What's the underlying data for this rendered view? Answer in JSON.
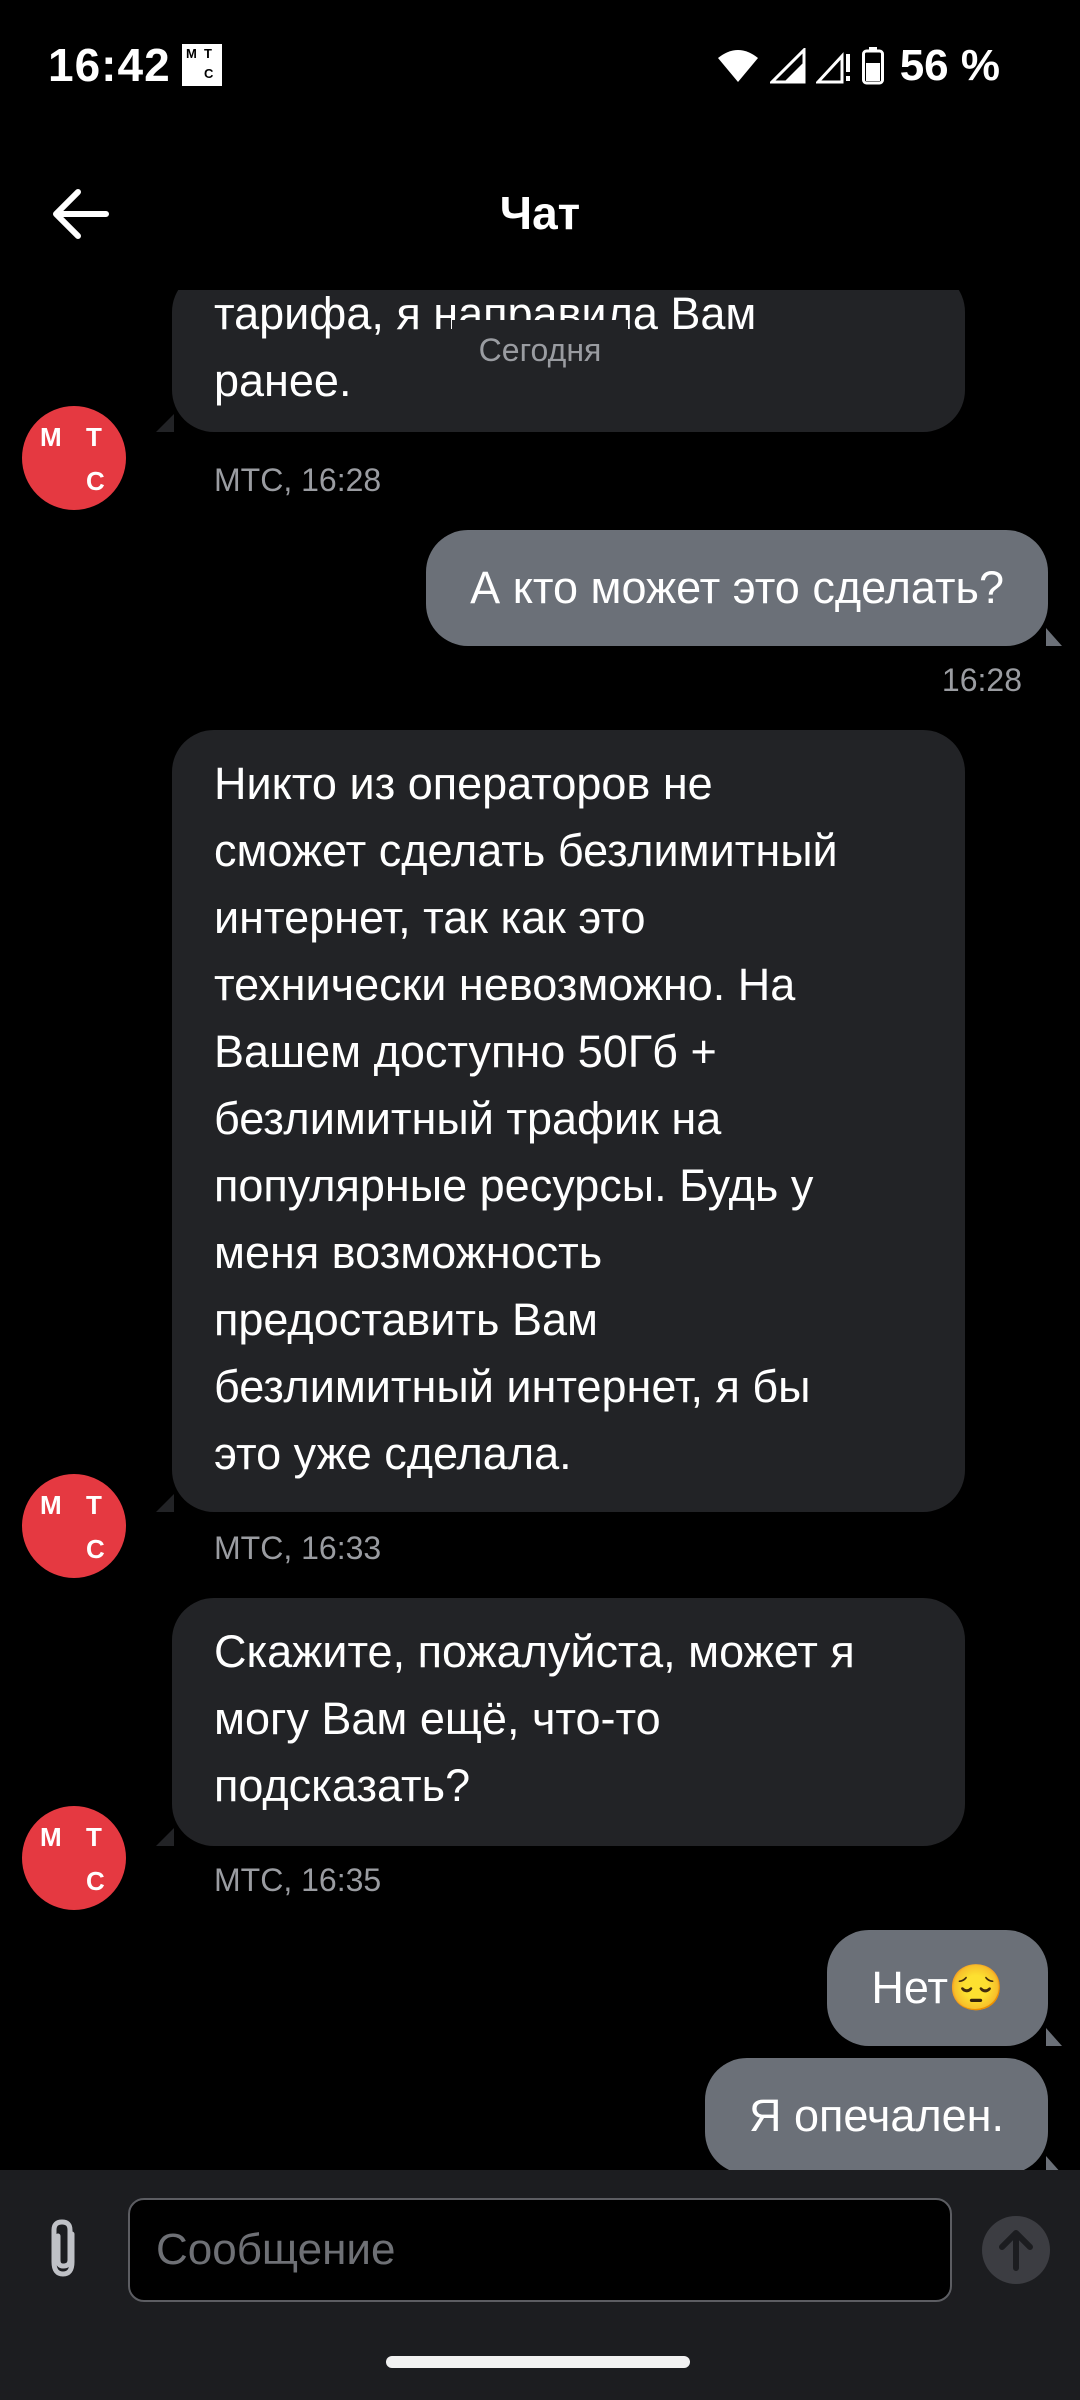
{
  "status_bar": {
    "time": "16:42",
    "carrier_logo_letters": [
      "М",
      "Т",
      "С"
    ],
    "battery_percent": "56 %",
    "icons": [
      "wifi-icon",
      "signal-icon",
      "signal-alert-icon",
      "battery-icon"
    ]
  },
  "header": {
    "title": "Чат",
    "back_icon": "arrow-left-icon"
  },
  "chat": {
    "date_separator": "Сегодня",
    "avatar_letters": [
      "М",
      "Т",
      "С"
    ],
    "messages": [
      {
        "from": "operator",
        "lines": [
          "тарифа, я направила Вам",
          "ранее."
        ],
        "meta": "МТС, 16:28"
      },
      {
        "from": "user",
        "text": "А кто может это сделать?",
        "meta": "16:28"
      },
      {
        "from": "operator",
        "lines": [
          "Никто из операторов не",
          "сможет сделать безлимитный",
          "интернет, так как это",
          "технически невозможно. На",
          "Вашем доступно 50Гб +",
          "безлимитный трафик на",
          "популярные ресурсы. Будь у",
          "меня возможность",
          "предоставить Вам",
          "безлимитный интернет, я бы",
          "это уже сделала."
        ],
        "meta": "МТС, 16:33"
      },
      {
        "from": "operator",
        "lines": [
          "Скажите, пожалуйста, может я",
          "могу Вам ещё, что-то",
          "подсказать?"
        ],
        "meta": "МТС, 16:35"
      },
      {
        "from": "user",
        "text": "Нет",
        "emoji": "😔"
      },
      {
        "from": "user",
        "text": "Я опечален."
      }
    ]
  },
  "input_bar": {
    "placeholder": "Сообщение",
    "value": "",
    "attach_icon": "paperclip-icon",
    "send_icon": "send-arrow-up-icon"
  },
  "colors": {
    "background": "#000000",
    "incoming_bubble": "#222326",
    "outgoing_bubble": "#6b7078",
    "brand_red": "#e53941",
    "meta_text": "#9a9ca1"
  }
}
